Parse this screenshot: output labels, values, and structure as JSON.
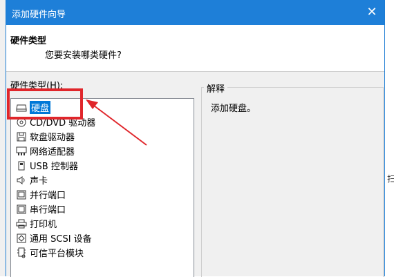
{
  "window": {
    "title": "添加硬件向导",
    "close_glyph": "✕"
  },
  "header": {
    "title": "硬件类型",
    "subtitle": "您要安装哪类硬件?"
  },
  "list": {
    "label": "硬件类型(H):",
    "items": [
      {
        "label": "硬盘",
        "icon": "hard-disk-icon",
        "selected": true
      },
      {
        "label": "CD/DVD 驱动器",
        "icon": "cd-dvd-icon"
      },
      {
        "label": "软盘驱动器",
        "icon": "floppy-icon"
      },
      {
        "label": "网络适配器",
        "icon": "network-adapter-icon"
      },
      {
        "label": "USB 控制器",
        "icon": "usb-icon"
      },
      {
        "label": "声卡",
        "icon": "speaker-icon"
      },
      {
        "label": "并行端口",
        "icon": "parallel-port-icon"
      },
      {
        "label": "串行端口",
        "icon": "serial-port-icon"
      },
      {
        "label": "打印机",
        "icon": "printer-icon"
      },
      {
        "label": "通用 SCSI 设备",
        "icon": "scsi-device-icon"
      },
      {
        "label": "可信平台模块",
        "icon": "tpm-icon"
      }
    ]
  },
  "explanation": {
    "label": "解释",
    "text": "添加硬盘。"
  },
  "colors": {
    "titlebar": "#1e7fd8",
    "selection": "#0078d7",
    "annotation": "#e0262b"
  },
  "edge_fragment": "扫"
}
